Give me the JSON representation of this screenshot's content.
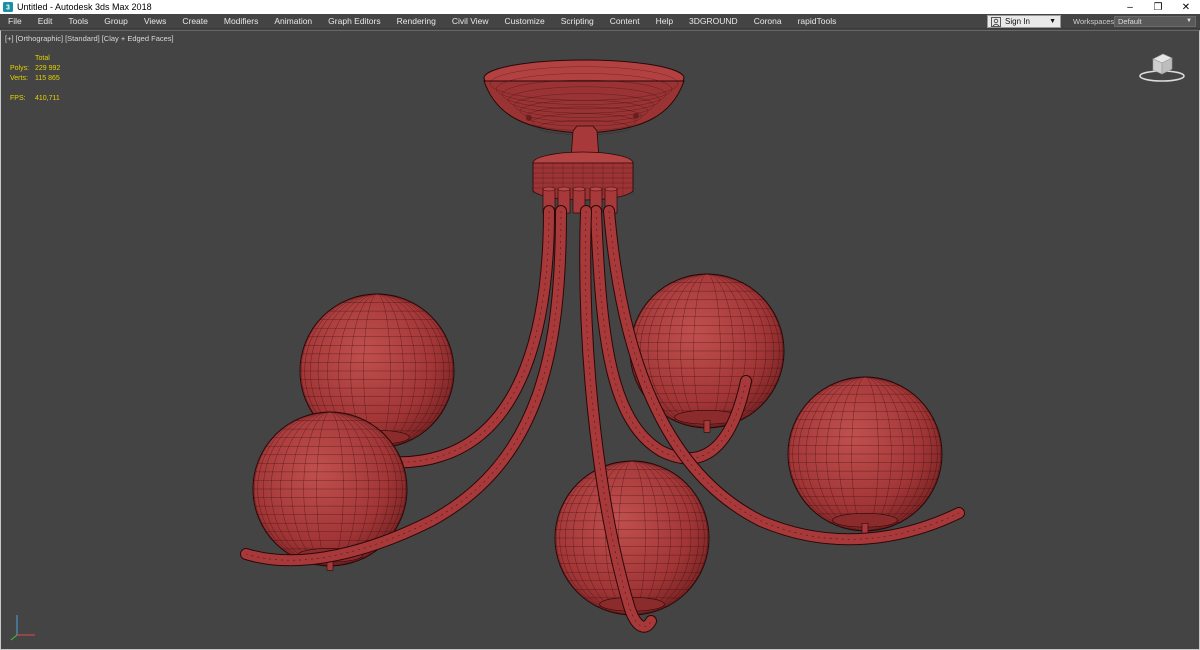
{
  "window": {
    "title": "Untitled - Autodesk 3ds Max 2018",
    "controls": {
      "minimize": "–",
      "restore": "❐",
      "close": "✕"
    }
  },
  "menubar": {
    "items": [
      "File",
      "Edit",
      "Tools",
      "Group",
      "Views",
      "Create",
      "Modifiers",
      "Animation",
      "Graph Editors",
      "Rendering",
      "Civil View",
      "Customize",
      "Scripting",
      "Content",
      "Help",
      "3DGROUND",
      "Corona",
      "rapidTools"
    ],
    "signin_label": "Sign In",
    "workspaces_label": "Workspaces:",
    "workspaces_value": "Default"
  },
  "viewport": {
    "labels": [
      "[+]",
      "[Orthographic]",
      "[Standard]",
      "[Clay + Edged Faces]"
    ],
    "stats": {
      "header": "Total",
      "polys_label": "Polys:",
      "polys_value": "229 992",
      "verts_label": "Verts:",
      "verts_value": "115 865",
      "fps_label": "FPS:",
      "fps_value": "410,711"
    }
  },
  "colors": {
    "viewport_bg": "#444444",
    "clay": "#a8393a",
    "wire": "#2a0808",
    "stats_text": "#e6d200",
    "menu_text": "#e8e8e8"
  },
  "icons": {
    "app": "3dsmax-app-icon",
    "user": "user-icon",
    "viewcube": "viewcube-icon",
    "axis": "axis-tripod-icon"
  }
}
